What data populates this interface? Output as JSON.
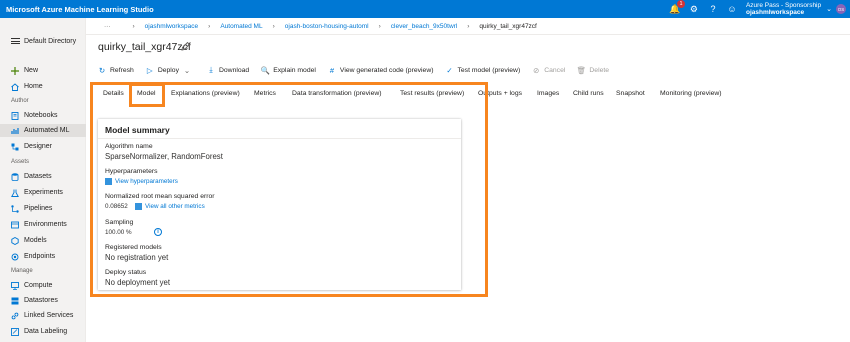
{
  "app": {
    "title": "Microsoft Azure Machine Learning Studio"
  },
  "topbar": {
    "notification_count": "1",
    "account_name": "Azure Pass - Sponsorship",
    "workspace_name": "ojashmlworkspace",
    "avatar_initials": "OS",
    "icons": [
      "bell-icon",
      "gear-icon",
      "help-icon",
      "smiley-icon",
      "chevron-down-icon"
    ]
  },
  "sidebar": {
    "directory": "Default Directory",
    "top_items": [
      {
        "label": "New",
        "icon": "plus-icon"
      },
      {
        "label": "Home",
        "icon": "home-icon"
      }
    ],
    "sections": [
      {
        "title": "Author",
        "items": [
          {
            "label": "Notebooks",
            "icon": "notebook-icon"
          },
          {
            "label": "Automated ML",
            "icon": "automl-icon",
            "active": true
          },
          {
            "label": "Designer",
            "icon": "designer-icon"
          }
        ]
      },
      {
        "title": "Assets",
        "items": [
          {
            "label": "Datasets",
            "icon": "dataset-icon"
          },
          {
            "label": "Experiments",
            "icon": "experiment-icon"
          },
          {
            "label": "Pipelines",
            "icon": "pipeline-icon"
          },
          {
            "label": "Environments",
            "icon": "environment-icon"
          },
          {
            "label": "Models",
            "icon": "model-icon"
          },
          {
            "label": "Endpoints",
            "icon": "endpoint-icon"
          }
        ]
      },
      {
        "title": "Manage",
        "items": [
          {
            "label": "Compute",
            "icon": "compute-icon"
          },
          {
            "label": "Datastores",
            "icon": "datastore-icon"
          },
          {
            "label": "Linked Services",
            "icon": "link-icon"
          },
          {
            "label": "Data Labeling",
            "icon": "label-icon"
          }
        ]
      }
    ]
  },
  "breadcrumb": {
    "overflow": "···",
    "items": [
      "ojashmlworkspace",
      "Automated ML",
      "ojash-boston-housing-automl",
      "clever_beach_9x50twrl"
    ],
    "current": "quirky_tail_xgr47zcf"
  },
  "page": {
    "title": "quirky_tail_xgr47zcf"
  },
  "toolbar": {
    "buttons": [
      {
        "label": "Refresh",
        "icon": "refresh-icon",
        "disabled": false
      },
      {
        "label": "Deploy",
        "icon": "deploy-icon",
        "disabled": false
      },
      {
        "label": "Download",
        "icon": "download-icon",
        "disabled": false
      },
      {
        "label": "Explain model",
        "icon": "explain-icon",
        "disabled": false
      },
      {
        "label": "View generated code (preview)",
        "icon": "code-icon",
        "disabled": false
      },
      {
        "label": "Test model (preview)",
        "icon": "test-icon",
        "disabled": false
      },
      {
        "label": "Cancel",
        "icon": "cancel-icon",
        "disabled": true
      },
      {
        "label": "Delete",
        "icon": "delete-icon",
        "disabled": true
      }
    ]
  },
  "tabs": [
    "Details",
    "Model",
    "Explanations (preview)",
    "Metrics",
    "Data transformation (preview)",
    "Test results (preview)",
    "Outputs + logs",
    "Images",
    "Child runs",
    "Snapshot",
    "Monitoring (preview)"
  ],
  "selected_tab": "Model",
  "model_summary": {
    "title": "Model summary",
    "algorithm_label": "Algorithm name",
    "algorithm_value": "SparseNormalizer, RandomForest",
    "hyperparameters_label": "Hyperparameters",
    "hyperparameters_link": "View hyperparameters",
    "nrmse_label": "Normalized root mean squared error",
    "nrmse_value": "0.08652",
    "metrics_link": "View all other metrics",
    "sampling_label": "Sampling",
    "sampling_value": "100.00 %",
    "registered_label": "Registered models",
    "registered_value": "No registration yet",
    "deploy_label": "Deploy status",
    "deploy_value": "No deployment yet"
  },
  "colors": {
    "brand": "#0078d4",
    "highlight": "#f7851f",
    "sidebar_bg": "#f3f2f1"
  }
}
